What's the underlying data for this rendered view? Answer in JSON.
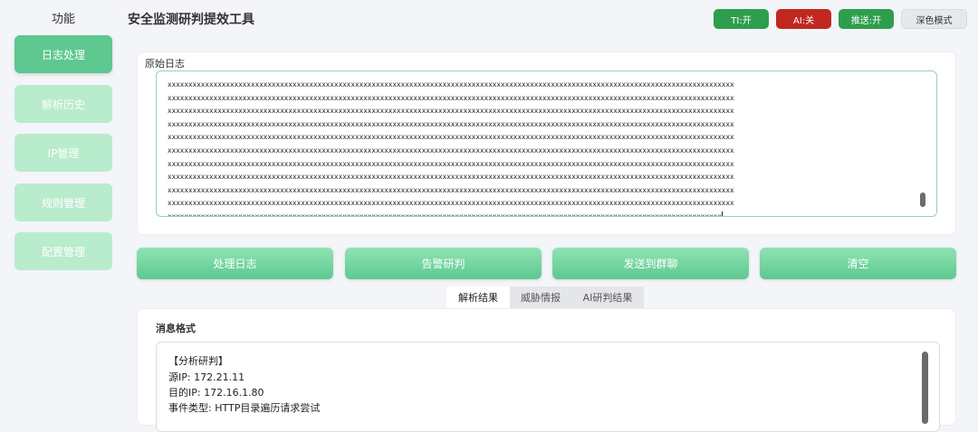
{
  "sidebar": {
    "title": "功能",
    "items": [
      {
        "label": "日志处理",
        "active": true
      },
      {
        "label": "解析历史",
        "active": false
      },
      {
        "label": "IP管理",
        "active": false
      },
      {
        "label": "规则管理",
        "active": false
      },
      {
        "label": "配置管理",
        "active": false
      }
    ]
  },
  "header": {
    "title": "安全监测研判提效工具",
    "toggles": {
      "ti": "TI:开",
      "ai": "AI:关",
      "push": "推送:开",
      "theme": "深色模式"
    }
  },
  "log_input": {
    "label": "原始日志",
    "lines": [
      "xxxxxxxxxxxxxxxxxxxxxxxxxxxxxxxxxxxxxxxxxxxxxxxxxxxxxxxxxxxxxxxxxxxxxxxxxxxxxxxxxxxxxxxxxxxxxxxxxxxxxxxxxxxxxxxxxxxxxxxxxxxxxxxxxxxxxxxx",
      "xxxxxxxxxxxxxxxxxxxxxxxxxxxxxxxxxxxxxxxxxxxxxxxxxxxxxxxxxxxxxxxxxxxxxxxxxxxxxxxxxxxxxxxxxxxxxxxxxxxxxxxxxxxxxxxxxxxxxxxxxxxxxxxxxxxxxxxx",
      "xxxxxxxxxxxxxxxxxxxxxxxxxxxxxxxxxxxxxxxxxxxxxxxxxxxxxxxxxxxxxxxxxxxxxxxxxxxxxxxxxxxxxxxxxxxxxxxxxxxxxxxxxxxxxxxxxxxxxxxxxxxxxxxxxxxxxxxx",
      "xxxxxxxxxxxxxxxxxxxxxxxxxxxxxxxxxxxxxxxxxxxxxxxxxxxxxxxxxxxxxxxxxxxxxxxxxxxxxxxxxxxxxxxxxxxxxxxxxxxxxxxxxxxxxxxxxxxxxxxxxxxxxxxxxxxxxxxx",
      "xxxxxxxxxxxxxxxxxxxxxxxxxxxxxxxxxxxxxxxxxxxxxxxxxxxxxxxxxxxxxxxxxxxxxxxxxxxxxxxxxxxxxxxxxxxxxxxxxxxxxxxxxxxxxxxxxxxxxxxxxxxxxxxxxxxxxxxx",
      "xxxxxxxxxxxxxxxxxxxxxxxxxxxxxxxxxxxxxxxxxxxxxxxxxxxxxxxxxxxxxxxxxxxxxxxxxxxxxxxxxxxxxxxxxxxxxxxxxxxxxxxxxxxxxxxxxxxxxxxxxxxxxxxxxxxxxxxx",
      "xxxxxxxxxxxxxxxxxxxxxxxxxxxxxxxxxxxxxxxxxxxxxxxxxxxxxxxxxxxxxxxxxxxxxxxxxxxxxxxxxxxxxxxxxxxxxxxxxxxxxxxxxxxxxxxxxxxxxxxxxxxxxxxxxxxxxxxx",
      "xxxxxxxxxxxxxxxxxxxxxxxxxxxxxxxxxxxxxxxxxxxxxxxxxxxxxxxxxxxxxxxxxxxxxxxxxxxxxxxxxxxxxxxxxxxxxxxxxxxxxxxxxxxxxxxxxxxxxxxxxxxxxxxxxxxxxxxx",
      "xxxxxxxxxxxxxxxxxxxxxxxxxxxxxxxxxxxxxxxxxxxxxxxxxxxxxxxxxxxxxxxxxxxxxxxxxxxxxxxxxxxxxxxxxxxxxxxxxxxxxxxxxxxxxxxxxxxxxxxxxxxxxxxxxxxxxxxx",
      "xxxxxxxxxxxxxxxxxxxxxxxxxxxxxxxxxxxxxxxxxxxxxxxxxxxxxxxxxxxxxxxxxxxxxxxxxxxxxxxxxxxxxxxxxxxxxxxxxxxxxxxxxxxxxxxxxxxxxxxxxxxxxxxxxxxxxxxx",
      "xxxxxxxxxxxxxxxxxxxxxxxxxxxxxxxxxxxxxxxxxxxxxxxxxxxxxxxxxxxxxxxxxxxxxxxxxxxxxxxxxxxxxxxxxxxxxxxxxxxxxxxxxxxxxxxxxxxxxxxxxxxxxxxxxxxxx"
    ]
  },
  "actions": {
    "process": "处理日志",
    "alert": "告警研判",
    "send": "发送到群聊",
    "clear": "清空"
  },
  "tabs": [
    {
      "label": "解析结果",
      "active": true
    },
    {
      "label": "威胁情报",
      "active": false
    },
    {
      "label": "AI研判结果",
      "active": false
    }
  ],
  "result": {
    "label": "消息格式",
    "lines": [
      "【分析研判】",
      "源IP: 172.21.11",
      "目的IP: 172.16.1.80",
      "事件类型: HTTP目录遍历请求尝试"
    ]
  },
  "colors": {
    "accent": "#5ec890",
    "on": "#2e9e4e",
    "off": "#c0281f"
  }
}
